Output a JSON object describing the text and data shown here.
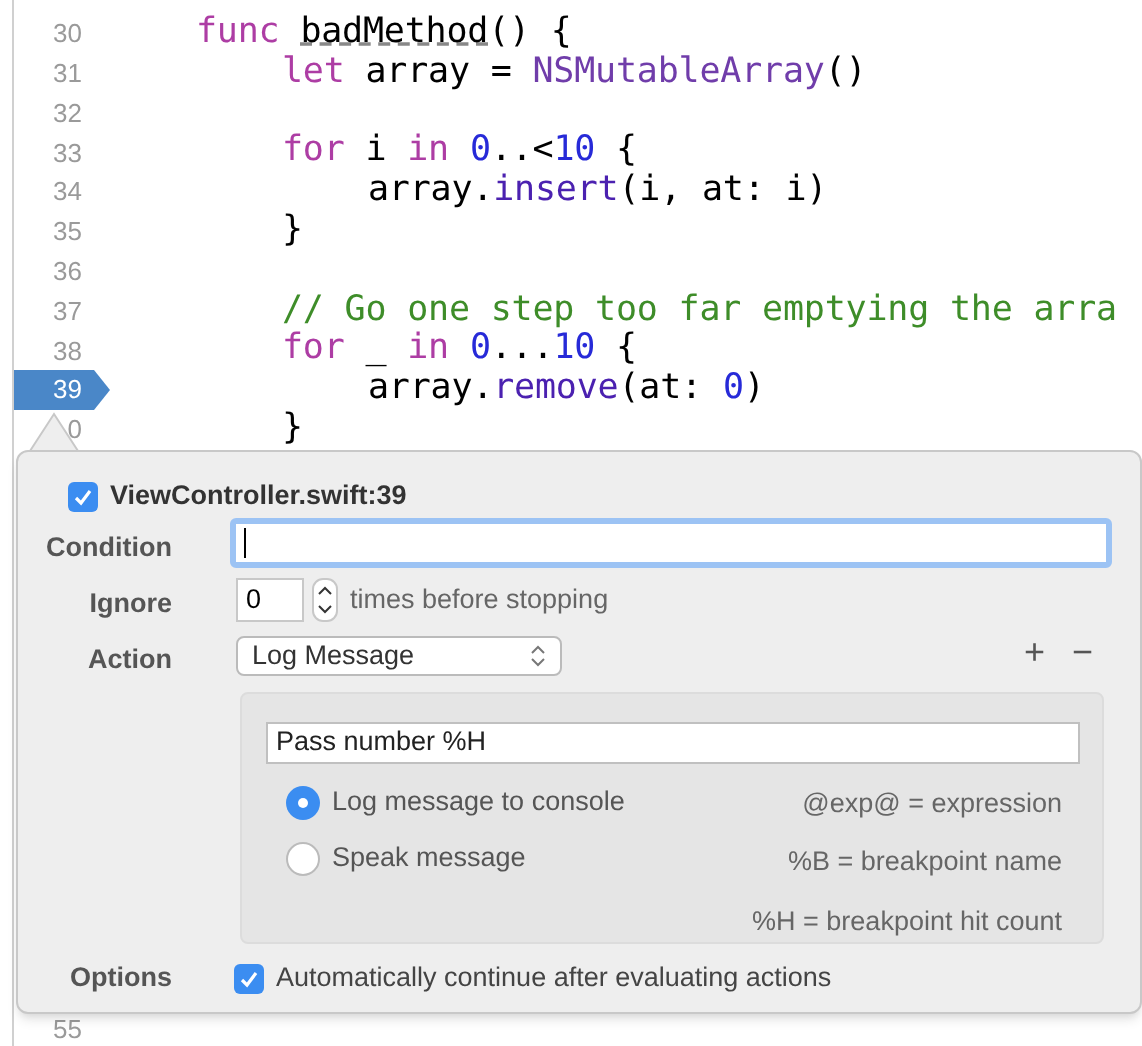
{
  "editor": {
    "lines": [
      {
        "number": "30",
        "breakpoint": false,
        "tokens": [
          {
            "kind": "keyword",
            "text": "func "
          },
          {
            "kind": "underlined",
            "text": "badMethod"
          },
          {
            "kind": "plain",
            "text": "() {"
          }
        ],
        "children": [
          {
            "number": "31",
            "breakpoint": false,
            "tokens": [
              {
                "kind": "keyword",
                "text": "let "
              },
              {
                "kind": "plain",
                "text": "array = "
              },
              {
                "kind": "type",
                "text": "NSMutableArray"
              },
              {
                "kind": "plain",
                "text": "()"
              }
            ]
          },
          {
            "number": "32",
            "breakpoint": false
          },
          {
            "number": "33",
            "breakpoint": false,
            "tokens": [
              {
                "kind": "keyword",
                "text": "for "
              },
              {
                "kind": "plain",
                "text": "i "
              },
              {
                "kind": "keyword",
                "text": "in "
              },
              {
                "kind": "number",
                "text": "0"
              },
              {
                "kind": "plain",
                "text": "..<"
              },
              {
                "kind": "number",
                "text": "10"
              },
              {
                "kind": "plain",
                "text": " {"
              }
            ],
            "children": [
              {
                "number": "34",
                "breakpoint": false,
                "tokens": [
                  {
                    "kind": "plain",
                    "text": "array."
                  },
                  {
                    "kind": "method",
                    "text": "insert"
                  },
                  {
                    "kind": "plain",
                    "text": "(i, at: i)"
                  }
                ]
              }
            ]
          },
          {
            "number": "35",
            "breakpoint": false,
            "tokens": [
              {
                "kind": "plain",
                "text": "}"
              }
            ]
          },
          {
            "number": "36",
            "breakpoint": false
          },
          {
            "number": "37",
            "breakpoint": false,
            "tokens": [
              {
                "kind": "comment",
                "text": "// Go one step too far emptying the arra"
              }
            ]
          },
          {
            "number": "38",
            "breakpoint": false,
            "tokens": [
              {
                "kind": "keyword",
                "text": "for "
              },
              {
                "kind": "plain",
                "text": "_ "
              },
              {
                "kind": "keyword",
                "text": "in "
              },
              {
                "kind": "number",
                "text": "0"
              },
              {
                "kind": "plain",
                "text": "..."
              },
              {
                "kind": "number",
                "text": "10"
              },
              {
                "kind": "plain",
                "text": " {"
              }
            ],
            "children": [
              {
                "number": "39",
                "breakpoint": true,
                "tokens": [
                  {
                    "kind": "plain",
                    "text": "array."
                  },
                  {
                    "kind": "method",
                    "text": "remove"
                  },
                  {
                    "kind": "plain",
                    "text": "(at: "
                  },
                  {
                    "kind": "number",
                    "text": "0"
                  },
                  {
                    "kind": "plain",
                    "text": ")"
                  }
                ]
              }
            ]
          },
          {
            "number": "0",
            "breakpoint": false,
            "tokens": [
              {
                "kind": "plain",
                "text": "}"
              }
            ]
          }
        ]
      }
    ],
    "bottom_line": "55"
  },
  "popover": {
    "enabled": true,
    "title": "ViewController.swift:39",
    "condition": {
      "label": "Condition"
    },
    "ignore": {
      "label": "Ignore",
      "value": "0",
      "suffix": "times before stopping"
    },
    "action": {
      "label": "Action",
      "value": "Log Message",
      "add": "+",
      "remove": "−"
    },
    "message": {
      "value": "Pass number %H"
    },
    "radios": [
      {
        "label": "Log message to console",
        "selected": true
      },
      {
        "label": "Speak message",
        "selected": false
      }
    ],
    "hints": [
      "@exp@ = expression",
      "%B = breakpoint name",
      "%H = breakpoint hit count"
    ],
    "options": {
      "label": "Options",
      "checked": true,
      "text": "Automatically continue after evaluating actions"
    }
  }
}
